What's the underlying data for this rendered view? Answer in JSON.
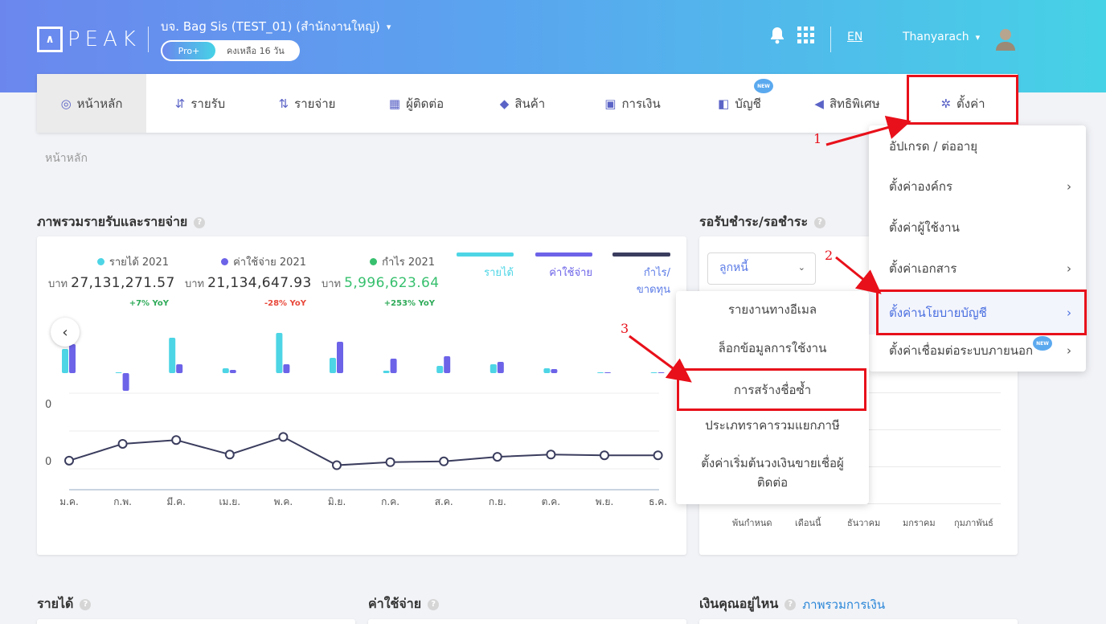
{
  "header": {
    "logo_text": "PEAK",
    "company_name": "บจ. Bag Sis (TEST_01) (สำนักงานใหญ่)",
    "plan_label": "Pro+",
    "plan_remaining": "คงเหลือ 16 วัน",
    "language": "EN",
    "user_name": "Thanyarach"
  },
  "nav": {
    "items": [
      {
        "label": "หน้าหลัก",
        "icon": "dashboard-icon"
      },
      {
        "label": "รายรับ",
        "icon": "income-icon"
      },
      {
        "label": "รายจ่าย",
        "icon": "expense-icon"
      },
      {
        "label": "ผู้ติดต่อ",
        "icon": "contacts-icon"
      },
      {
        "label": "สินค้า",
        "icon": "product-icon"
      },
      {
        "label": "การเงิน",
        "icon": "finance-icon"
      },
      {
        "label": "บัญชี",
        "icon": "account-icon",
        "badge": "NEW"
      },
      {
        "label": "สิทธิพิเศษ",
        "icon": "megaphone-icon"
      },
      {
        "label": "ตั้งค่า",
        "icon": "gear-icon"
      }
    ]
  },
  "breadcrumb": "หน้าหลัก",
  "overview": {
    "title": "ภาพรวมรายรับและรายจ่าย",
    "kpis": [
      {
        "label": "รายได้ 2021",
        "currency": "บาท",
        "value": "27,131,271.57",
        "yoy": "+7% YoY",
        "color": "#4dd5e5",
        "value_color": "#333333",
        "yoy_color": "#2eaa58"
      },
      {
        "label": "ค่าใช้จ่าย 2021",
        "currency": "บาท",
        "value": "21,134,647.93",
        "yoy": "-28% YoY",
        "color": "#6c63e8",
        "value_color": "#333333",
        "yoy_color": "#e8483a"
      },
      {
        "label": "กำไร 2021",
        "currency": "บาท",
        "value": "5,996,623.64",
        "yoy": "+253% YoY",
        "color": "#37c06e",
        "value_color": "#37c06e",
        "yoy_color": "#2eaa58"
      }
    ],
    "legend": [
      {
        "label": "รายได้",
        "color": "#4dd5e5"
      },
      {
        "label": "ค่าใช้จ่าย",
        "color": "#6c63e8"
      },
      {
        "label": "กำไร/ขาดทุน",
        "color": "#3b3d5e"
      }
    ],
    "y_tick_top": "0",
    "y_tick_bottom": "0"
  },
  "chart_data": {
    "type": "bar",
    "categories": [
      "ม.ค.",
      "ก.พ.",
      "มี.ค.",
      "เม.ย.",
      "พ.ค.",
      "มิ.ย.",
      "ก.ค.",
      "ส.ค.",
      "ก.ย.",
      "ต.ค.",
      "พ.ย.",
      "ธ.ค."
    ],
    "series": [
      {
        "name": "รายได้",
        "values": [
          30,
          1,
          44,
          6,
          50,
          19,
          3,
          9,
          11,
          6,
          1,
          1
        ],
        "color": "#4dd5e5"
      },
      {
        "name": "ค่าใช้จ่าย",
        "values": [
          36,
          -22,
          11,
          4,
          11,
          39,
          18,
          21,
          14,
          5,
          1,
          1
        ],
        "color": "#6c63e8"
      },
      {
        "name": "กำไร/ขาดทุน",
        "values": [
          -3,
          19,
          24,
          5,
          28,
          -9,
          -5,
          -4,
          2,
          5,
          4,
          4
        ],
        "color": "#3b3d5e"
      }
    ],
    "xlabel": "",
    "ylabel": ""
  },
  "receivables": {
    "title": "รอรับชำระ/รอชำระ",
    "select_value": "ลูกหนี้",
    "x_labels": [
      "พ้นกำหนด",
      "เดือนนี้",
      "ธันวาคม",
      "มกราคม",
      "กุมภาพันธ์"
    ]
  },
  "settings_menu": {
    "items": [
      {
        "label": "อัปเกรด / ต่ออายุ",
        "has_arrow": false
      },
      {
        "label": "ตั้งค่าองค์กร",
        "has_arrow": true
      },
      {
        "label": "ตั้งค่าผู้ใช้งาน",
        "has_arrow": false
      },
      {
        "label": "ตั้งค่าเอกสาร",
        "has_arrow": true
      },
      {
        "label": "ตั้งค่านโยบายบัญชี",
        "has_arrow": true
      },
      {
        "label": "ตั้งค่าเชื่อมต่อระบบภายนอก",
        "has_arrow": true,
        "badge": "NEW"
      }
    ]
  },
  "submenu": {
    "items": [
      {
        "label": "รายงานทางอีเมล"
      },
      {
        "label": "ล็อกข้อมูลการใช้งาน"
      },
      {
        "label": "การสร้างชื่อซ้ำ"
      },
      {
        "label": "ประเภทราคารวมแยกภาษี"
      },
      {
        "label": "ตั้งค่าเริ่มต้นวงเงินขายเชื่อผู้ติดต่อ"
      }
    ]
  },
  "annotations": {
    "step1": "1",
    "step2": "2",
    "step3": "3"
  },
  "bottom_sections": {
    "revenue_title": "รายได้",
    "expense_title": "ค่าใช้จ่าย",
    "cash_title": "เงินคุณอยู่ไหน",
    "cash_link": "ภาพรวมการเงิน"
  }
}
